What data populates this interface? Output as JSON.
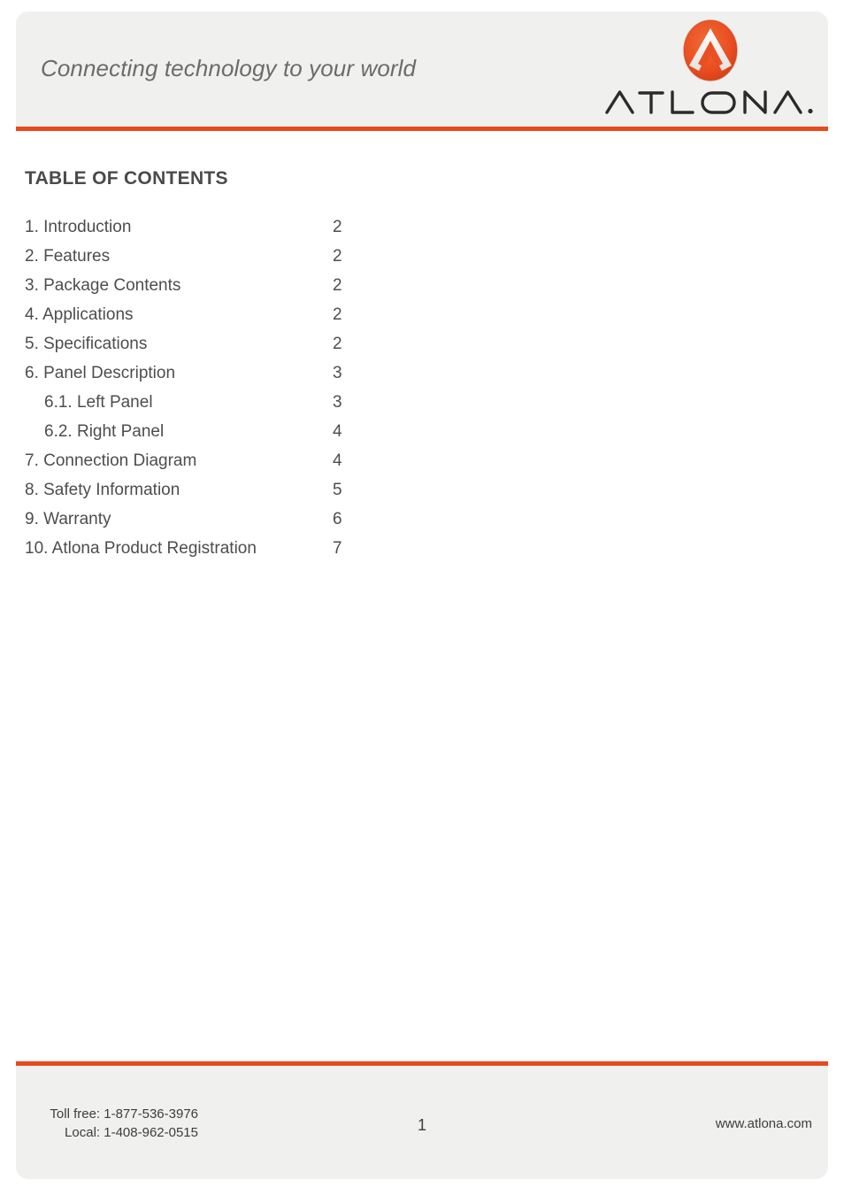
{
  "colors": {
    "accent": "#e8491f",
    "band": "#f0f0ee",
    "text": "#4d4d4d",
    "heading": "#4a4a4a",
    "page": "#ffffff"
  },
  "header": {
    "tagline": "Connecting technology to your world",
    "logo_wordmark": "ATLONA.",
    "logo_mark_name": "atlona-circle-chevron-logo"
  },
  "toc": {
    "title": "TABLE OF CONTENTS",
    "entries": [
      {
        "label": "1. Introduction",
        "page": "2",
        "sub": false
      },
      {
        "label": "2. Features",
        "page": "2",
        "sub": false
      },
      {
        "label": "3. Package Contents",
        "page": "2",
        "sub": false
      },
      {
        "label": "4. Applications",
        "page": "2",
        "sub": false
      },
      {
        "label": "5. Specifications",
        "page": "2",
        "sub": false
      },
      {
        "label": "6. Panel Description",
        "page": "3",
        "sub": false
      },
      {
        "label": "6.1. Left Panel",
        "page": "3",
        "sub": true
      },
      {
        "label": "6.2. Right Panel",
        "page": "4",
        "sub": true
      },
      {
        "label": "7. Connection Diagram",
        "page": "4",
        "sub": false
      },
      {
        "label": "8. Safety Information",
        "page": "5",
        "sub": false
      },
      {
        "label": "9. Warranty",
        "page": "6",
        "sub": false
      },
      {
        "label": "10. Atlona Product Registration",
        "page": "7",
        "sub": false
      }
    ]
  },
  "footer": {
    "toll_free": "Toll free: 1-877-536-3976",
    "local": "Local: 1-408-962-0515",
    "page_number": "1",
    "website": "www.atlona.com"
  }
}
